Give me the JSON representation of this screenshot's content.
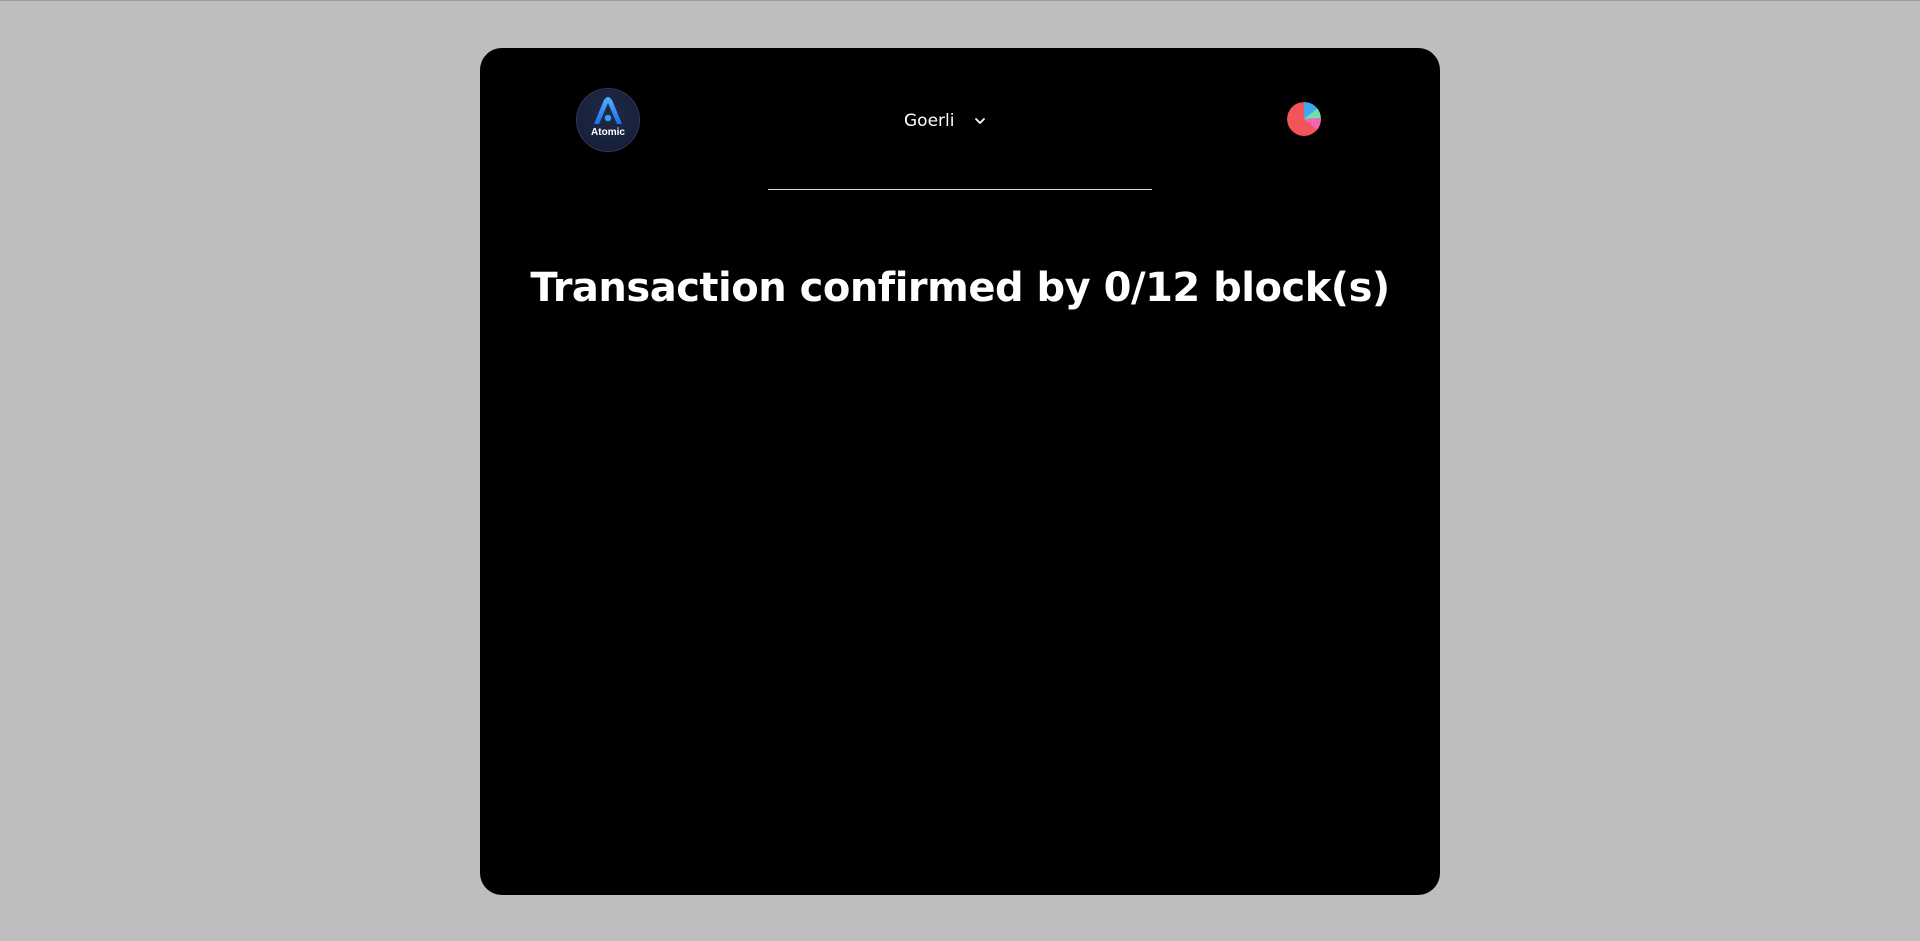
{
  "header": {
    "logo": {
      "icon": "atomic-wallet-logo",
      "text": "Atomic"
    },
    "network_selector": {
      "selected": "Goerli",
      "icon": "chevron-down-icon"
    },
    "account_avatar": {
      "icon": "jazzicon-avatar",
      "colors": [
        "#f2545b",
        "#3ea7f2",
        "#6fe0a8",
        "#f266b0"
      ]
    }
  },
  "main": {
    "status_title": "Transaction confirmed by 0/12 block(s)"
  },
  "colors": {
    "page_background": "#bebebe",
    "card_background": "#000000",
    "text": "#ffffff",
    "logo_accent": "#2b8cf0"
  }
}
